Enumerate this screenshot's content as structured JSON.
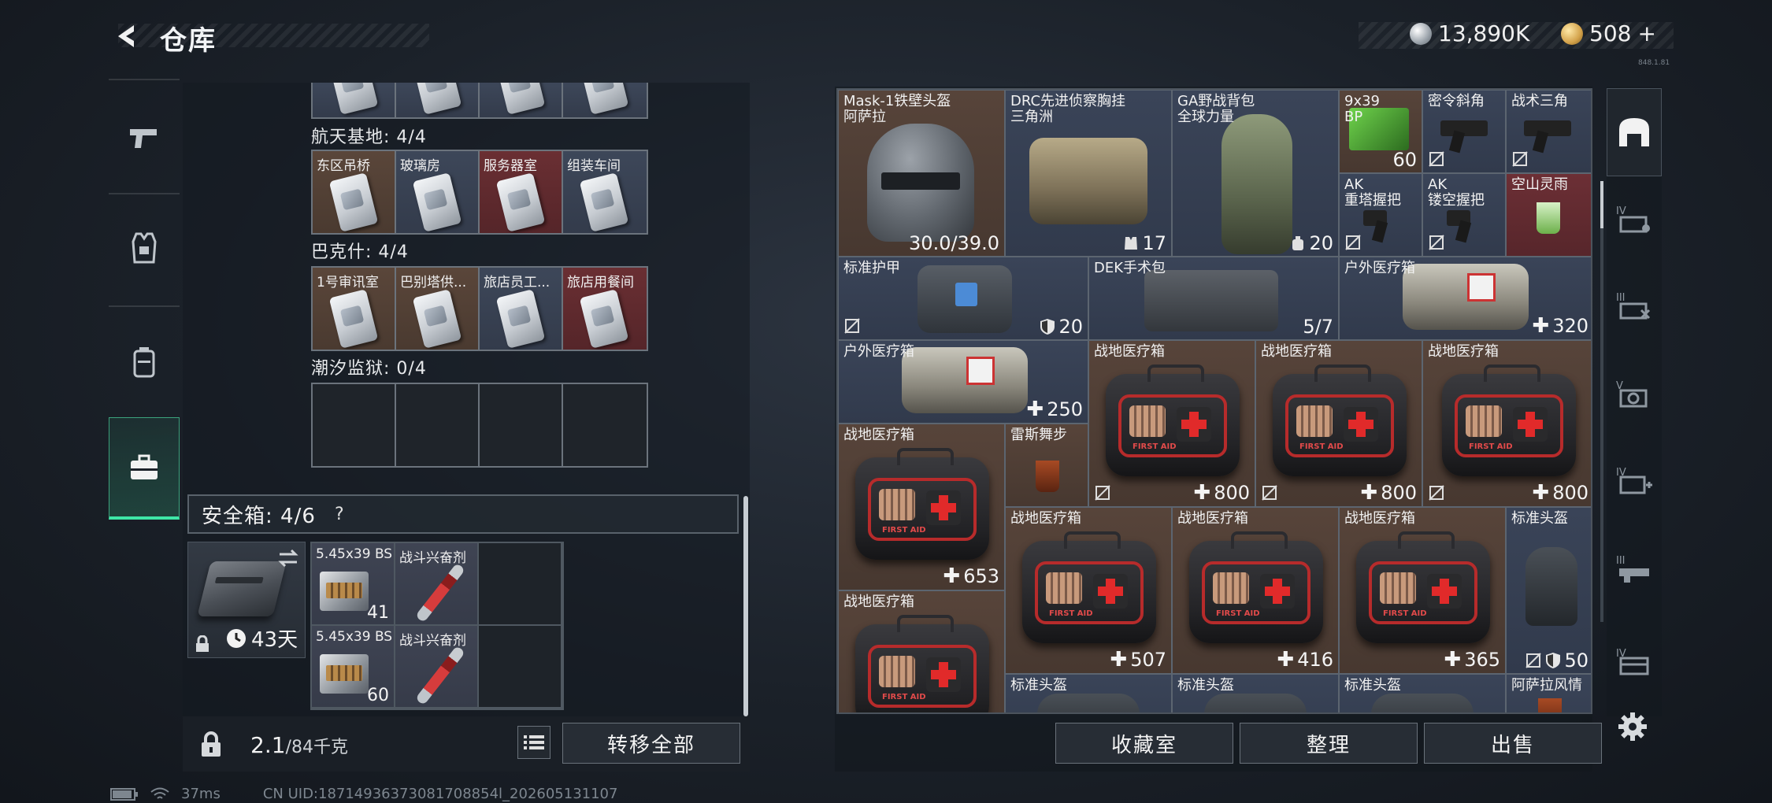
{
  "header": {
    "title": "仓库",
    "currency": [
      {
        "icon": "silver-coin-icon",
        "amount": "13,890K"
      },
      {
        "icon": "gold-coin-icon",
        "amount": "508",
        "add": "+"
      }
    ],
    "version_tag": "848.1.81"
  },
  "left_nav": [
    {
      "icon": "pistol-icon",
      "active": false
    },
    {
      "icon": "vest-icon",
      "active": false
    },
    {
      "icon": "backpack-icon",
      "active": false
    },
    {
      "icon": "briefcase-icon",
      "active": true
    }
  ],
  "keys_section": {
    "groups": [
      {
        "label": "航天基地: 4/4",
        "cells": [
          {
            "name": "东区吊桥",
            "color": "brown"
          },
          {
            "name": "玻璃房",
            "color": "blue"
          },
          {
            "name": "服务器室",
            "color": "red"
          },
          {
            "name": "组装车间",
            "color": "blue"
          }
        ]
      },
      {
        "label": "巴克什: 4/4",
        "cells": [
          {
            "name": "1号审讯室",
            "color": "brown"
          },
          {
            "name": "巴别塔供...",
            "color": "brown"
          },
          {
            "name": "旅店员工...",
            "color": "blue"
          },
          {
            "name": "旅店用餐间",
            "color": "red"
          }
        ]
      },
      {
        "label": "潮汐监狱: 0/4",
        "cells": []
      }
    ]
  },
  "safe_box": {
    "label": "安全箱: 4/6",
    "help": "?",
    "days": "43天",
    "items": [
      {
        "name": "5.45x39 BS",
        "count": "41"
      },
      {
        "name": "战斗兴奋剂",
        "count": ""
      },
      {
        "name": "5.45x39 BS",
        "count": "60"
      },
      {
        "name": "战斗兴奋剂",
        "count": ""
      }
    ]
  },
  "footer_left": {
    "weight": "2.1",
    "weight_unit": "/84千克",
    "transfer_all": "转移全部"
  },
  "stash": {
    "items": {
      "mask": {
        "name": "Mask-1铁壁头盔\n阿萨拉",
        "value": "30.0/39.0"
      },
      "drc": {
        "name": "DRC先进侦察胸挂\n三角洲",
        "value": "17"
      },
      "ga": {
        "name": "GA野战背包\n全球力量",
        "value": "20"
      },
      "ammo939": {
        "name": "9x39\nBP",
        "value": "60"
      },
      "grip1": {
        "name": "密令斜角"
      },
      "grip2": {
        "name": "战术三角"
      },
      "ak1": {
        "name": "AK\n重塔握把"
      },
      "ak2": {
        "name": "AK\n镂空握把"
      },
      "kongshan": {
        "name": "空山灵雨"
      },
      "armor": {
        "name": "标准护甲",
        "value": "20"
      },
      "dek": {
        "name": "DEK手术包",
        "value": "5/7"
      },
      "outdoor1": {
        "name": "户外医疗箱",
        "value": "320"
      },
      "outdoor2": {
        "name": "户外医疗箱",
        "value": "250"
      },
      "med1": {
        "name": "战地医疗箱",
        "value": "800"
      },
      "med2": {
        "name": "战地医疗箱",
        "value": "800"
      },
      "med3": {
        "name": "战地医疗箱",
        "value": "800"
      },
      "med4": {
        "name": "战地医疗箱",
        "value": "653"
      },
      "leisi": {
        "name": "雷斯舞步"
      },
      "med5": {
        "name": "战地医疗箱",
        "value": "507"
      },
      "med6": {
        "name": "战地医疗箱",
        "value": "416"
      },
      "med7": {
        "name": "战地医疗箱",
        "value": "365"
      },
      "stdhelmet": {
        "name": "标准头盔",
        "value": "50"
      },
      "med8": {
        "name": "战地医疗箱"
      },
      "stdhelm2": {
        "name": "标准头盔"
      },
      "stdhelm3": {
        "name": "标准头盔"
      },
      "stdhelm4": {
        "name": "标准头盔"
      },
      "asala": {
        "name": "阿萨拉风情"
      }
    }
  },
  "footer_right": {
    "collection": "收藏室",
    "organize": "整理",
    "sell": "出售"
  },
  "status": {
    "ping": "37ms",
    "uid": "CN UID:18714936373081708854l_202605131107"
  },
  "colors": {
    "accent": "#3ee6a6",
    "brown_slot": "#57443a",
    "blue_slot": "#3a4458",
    "red_slot": "#6c2f35"
  }
}
